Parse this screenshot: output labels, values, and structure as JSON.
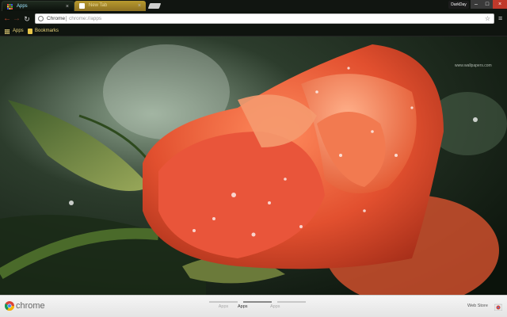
{
  "tabs": [
    {
      "label": "Apps",
      "close": "×",
      "active": true
    },
    {
      "label": "New Tab",
      "close": "×",
      "active": false
    }
  ],
  "window": {
    "profile_label": "DarkDay",
    "min": "–",
    "max": "□",
    "close": "×"
  },
  "toolbar": {
    "back": "←",
    "forward": "→",
    "reload": "↻",
    "omnibox_chip": "Chrome",
    "omnibox_url": "chrome://apps",
    "star": "☆",
    "menu": "≡"
  },
  "bookmarks": [
    {
      "label": "Apps"
    },
    {
      "label": "Bookmarks"
    }
  ],
  "watermark": "www.wallpapers.com",
  "bottom": {
    "brand": "chrome",
    "pages": [
      "Apps",
      "Apps",
      "Apps"
    ],
    "webstore": "Web Store"
  },
  "colors": {
    "tab_apps_text": "#9fe6ff",
    "tab_newtab_bg": "#b89a2f",
    "bookmark_text": "#e8d37a",
    "nav_arrows": "#c84c2a",
    "close_button": "#c0392b"
  }
}
